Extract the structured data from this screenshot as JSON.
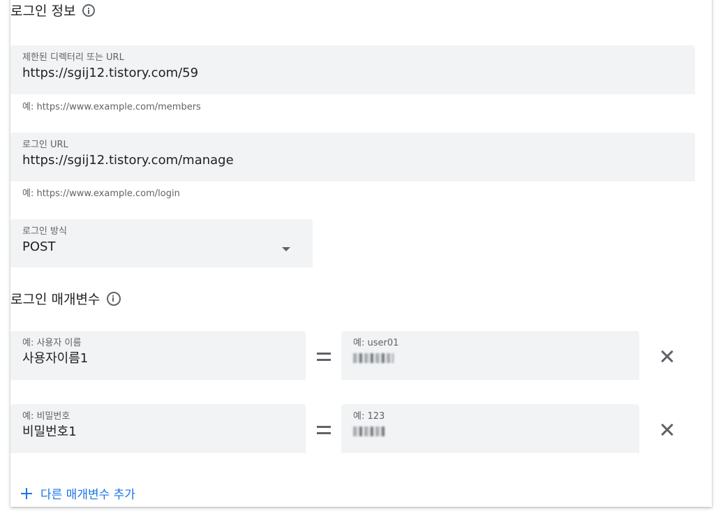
{
  "login_info": {
    "title": "로그인 정보",
    "restricted": {
      "label": "제한된 디렉터리 또는 URL",
      "value": "https://sgij12.tistory.com/59",
      "helper": "예: https://www.example.com/members"
    },
    "login_url": {
      "label": "로그인 URL",
      "value": "https://sgij12.tistory.com/manage",
      "helper": "예: https://www.example.com/login"
    },
    "method": {
      "label": "로그인 방식",
      "value": "POST"
    }
  },
  "login_params": {
    "title": "로그인 매개변수",
    "rows": [
      {
        "name_placeholder": "예: 사용자 이름",
        "name_value": "사용자이름1",
        "value_placeholder": "예: user01"
      },
      {
        "name_placeholder": "예: 비밀번호",
        "name_value": "비밀번호1",
        "value_placeholder": "예: 123"
      }
    ],
    "add_label": "다른 매개변수 추가"
  },
  "icons": {
    "info": "info-icon",
    "dropdown": "dropdown-arrow-icon",
    "equals": "equals-icon",
    "close": "close-icon",
    "plus": "plus-icon"
  },
  "colors": {
    "accent": "#1a73e8",
    "field_bg": "#f1f3f4",
    "text": "#202124",
    "secondary_text": "#5f6368"
  }
}
